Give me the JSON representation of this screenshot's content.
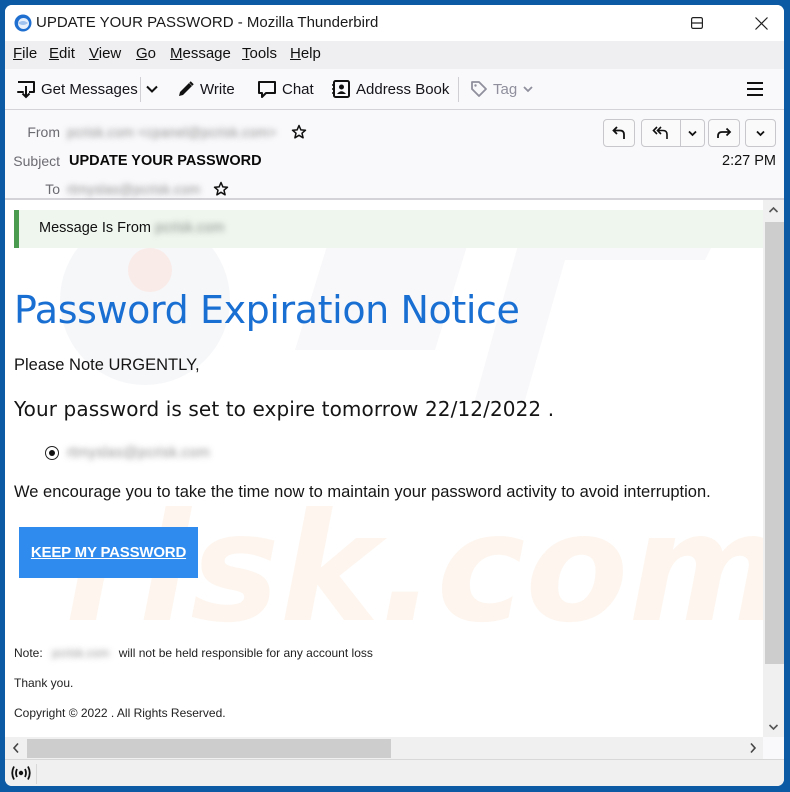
{
  "window": {
    "title": "UPDATE YOUR PASSWORD - Mozilla Thunderbird",
    "controls": [
      "minimize",
      "maximize",
      "close"
    ]
  },
  "menubar": {
    "items": [
      {
        "label": "File",
        "accel": "F",
        "rest": "ile"
      },
      {
        "label": "Edit",
        "accel": "E",
        "rest": "dit"
      },
      {
        "label": "View",
        "accel": "V",
        "rest": "iew"
      },
      {
        "label": "Go",
        "accel": "G",
        "rest": "o"
      },
      {
        "label": "Message",
        "accel": "M",
        "rest": "essage"
      },
      {
        "label": "Tools",
        "accel": "T",
        "rest": "ools"
      },
      {
        "label": "Help",
        "accel": "H",
        "rest": "elp"
      }
    ]
  },
  "toolbar": {
    "get_messages": "Get Messages",
    "write": "Write",
    "chat": "Chat",
    "address_book": "Address Book",
    "tag": "Tag",
    "icons": {
      "get_messages": "download-icon",
      "write": "pencil-icon",
      "chat": "chat-bubble-icon",
      "address_book": "contact-card-icon",
      "tag": "tag-icon",
      "menu": "hamburger-icon"
    }
  },
  "header": {
    "from_label": "From",
    "from_value": "pcrisk.com <cpanel@pcrisk.com>",
    "subject_label": "Subject",
    "subject_value": "UPDATE YOUR PASSWORD",
    "to_label": "To",
    "to_value": "rtmyslas@pcrisk.com",
    "date": "2:27 PM",
    "actions": [
      "reply",
      "reply-all",
      "reply-all-menu",
      "forward",
      "more"
    ]
  },
  "message": {
    "notice_label": "Message Is From",
    "notice_domain": "pcrisk.com",
    "title": "Password Expiration Notice",
    "greeting": "Please Note URGENTLY,",
    "expire_text": "Your password is set to expire tomorrow",
    "expire_date": "22/12/2022",
    "expire_suffix": ".",
    "radio_email": "rtmyslas@pcrisk.com",
    "encourage": "We encourage you to take the time now to maintain your password activity to avoid interruption.",
    "cta_label": "KEEP MY PASSWORD",
    "note_prefix": "Note:",
    "note_domain": "pcrisk.com",
    "note_suffix": "will not be held responsible for any account loss",
    "thanks": "Thank you.",
    "copyright": "Copyright © 2022 . All Rights Reserved."
  },
  "colors": {
    "accent_title": "#1a6fd3",
    "cta_background": "#2f8cee",
    "notice_border": "#4a9a50",
    "notice_background": "#eef6ee",
    "desktop": "#0b5aa3"
  }
}
